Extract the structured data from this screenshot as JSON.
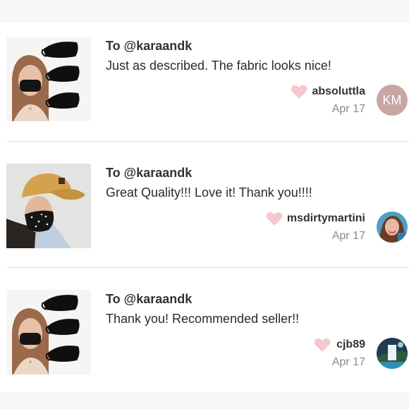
{
  "reviews": [
    {
      "to": "To @karaandk",
      "message": "Just as described. The fabric looks nice!",
      "username": "absoluttla",
      "date": "Apr 17",
      "avatar_initials": "KM",
      "avatar_color": "#c9a6a1",
      "thumbnail": "woman-with-black-masks-photo"
    },
    {
      "to": "To @karaandk",
      "message": "Great Quality!!! Love it! Thank you!!!!",
      "username": "msdirtymartini",
      "date": "Apr 17",
      "avatar_initials": "",
      "thumbnail": "woman-with-cap-and-star-mask-photo"
    },
    {
      "to": "To @karaandk",
      "message": "Thank you! Recommended seller!!",
      "username": "cjb89",
      "date": "Apr 17",
      "avatar_initials": "",
      "thumbnail": "woman-with-black-masks-photo"
    }
  ],
  "colors": {
    "heart": "#f7c6cf",
    "divider": "#dddddd",
    "date_text": "#8a8a8a"
  },
  "icons": {
    "like": "heart-icon"
  }
}
